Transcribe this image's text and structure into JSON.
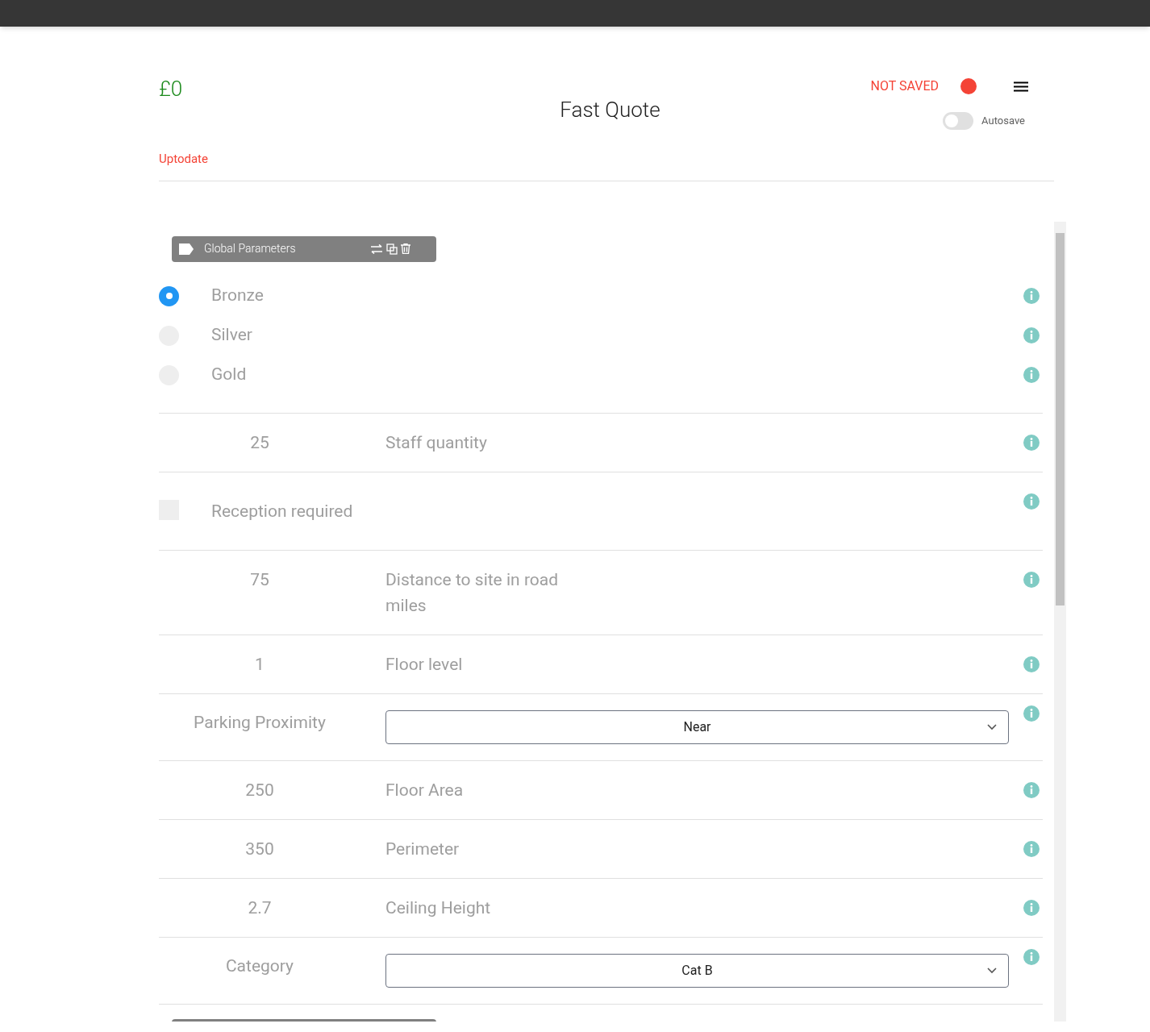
{
  "header": {
    "price": "£0",
    "title": "Fast Quote",
    "status": "NOT SAVED",
    "saved": false,
    "autosave": {
      "label": "Autosave",
      "on": false
    },
    "update_link": "Uptodate"
  },
  "sections": [
    {
      "title": "Global Parameters",
      "rows": [
        {
          "kind": "radio",
          "options": [
            {
              "label": "Bronze",
              "selected": true
            },
            {
              "label": "Silver",
              "selected": false
            },
            {
              "label": "Gold",
              "selected": false
            }
          ]
        },
        {
          "kind": "number",
          "value": "25",
          "label": "Staff quantity"
        },
        {
          "kind": "checkbox",
          "label": "Reception required",
          "checked": false
        },
        {
          "kind": "number",
          "value": "75",
          "label": "Distance to site in road miles"
        },
        {
          "kind": "number",
          "value": "1",
          "label": "Floor level"
        },
        {
          "kind": "select",
          "label": "Parking Proximity",
          "value": "Near"
        },
        {
          "kind": "number",
          "value": "250",
          "label": "Floor Area"
        },
        {
          "kind": "number",
          "value": "350",
          "label": "Perimeter"
        },
        {
          "kind": "number",
          "value": "2.7",
          "label": "Ceiling Height"
        },
        {
          "kind": "select",
          "label": "Category",
          "value": "Cat B"
        }
      ]
    }
  ]
}
